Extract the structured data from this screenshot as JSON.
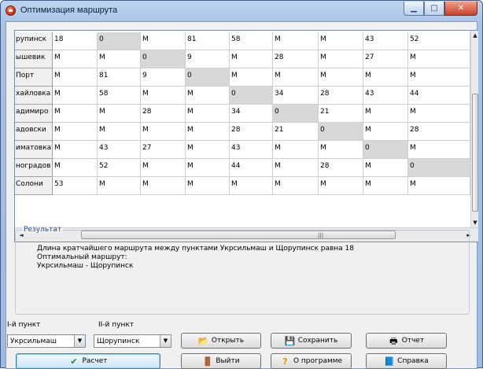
{
  "window": {
    "title": "Оптимизация маршрута"
  },
  "table": {
    "rows": [
      {
        "name": "рупинск",
        "cells": [
          "18",
          "0",
          "М",
          "81",
          "58",
          "М",
          "М",
          "43",
          "52"
        ]
      },
      {
        "name": "ышевик",
        "cells": [
          "М",
          "М",
          "0",
          "9",
          "М",
          "28",
          "М",
          "27",
          "М"
        ]
      },
      {
        "name": "Порт",
        "cells": [
          "М",
          "81",
          "9",
          "0",
          "М",
          "М",
          "М",
          "М",
          "М"
        ]
      },
      {
        "name": "хайловка",
        "cells": [
          "М",
          "58",
          "М",
          "М",
          "0",
          "34",
          "28",
          "43",
          "44"
        ]
      },
      {
        "name": "адимиро",
        "cells": [
          "М",
          "М",
          "28",
          "М",
          "34",
          "0",
          "21",
          "М",
          "М"
        ]
      },
      {
        "name": "адовски",
        "cells": [
          "М",
          "М",
          "М",
          "М",
          "28",
          "21",
          "0",
          "М",
          "28"
        ]
      },
      {
        "name": "иматовка",
        "cells": [
          "М",
          "43",
          "27",
          "М",
          "43",
          "М",
          "М",
          "0",
          "М"
        ]
      },
      {
        "name": "ноградов",
        "cells": [
          "М",
          "52",
          "М",
          "М",
          "44",
          "М",
          "28",
          "М",
          "0"
        ]
      },
      {
        "name": "Солони",
        "cells": [
          "53",
          "М",
          "М",
          "М",
          "М",
          "М",
          "М",
          "М",
          "М"
        ]
      }
    ],
    "diagonal": [
      [
        0,
        1
      ],
      [
        1,
        2
      ],
      [
        2,
        3
      ],
      [
        3,
        4
      ],
      [
        4,
        5
      ],
      [
        5,
        6
      ],
      [
        6,
        7
      ],
      [
        7,
        8
      ]
    ]
  },
  "result": {
    "legend": "Результат",
    "line1": "Длина кратчайшего маршрута между пунктами Укрсильмаш и Щорупинск равна 18",
    "line2": "Оптимальный маршрут:",
    "line3": "Укрсильмаш - Щорупинск"
  },
  "controls": {
    "point1_label": "I-й пункт",
    "point2_label": "II-й пункт",
    "point1_value": "Укрсильмаш",
    "point2_value": "Щорупинск",
    "open_label": "Открыть",
    "save_label": "Сохранить",
    "report_label": "Отчет",
    "calc_label": "Расчет",
    "exit_label": "Выйти",
    "about_label": "О программе",
    "help_label": "Справка"
  },
  "icons": {
    "app": "route-app-icon",
    "open": "open-file-icon",
    "save": "save-icon",
    "report": "printer-icon",
    "calc": "checkmark-icon",
    "exit": "exit-door-icon",
    "about": "question-icon",
    "help": "help-book-icon"
  },
  "colors": {
    "accent": "#1c4fa8",
    "diagonal_bg": "#d8d8d8",
    "close_btn": "#c7422a"
  }
}
